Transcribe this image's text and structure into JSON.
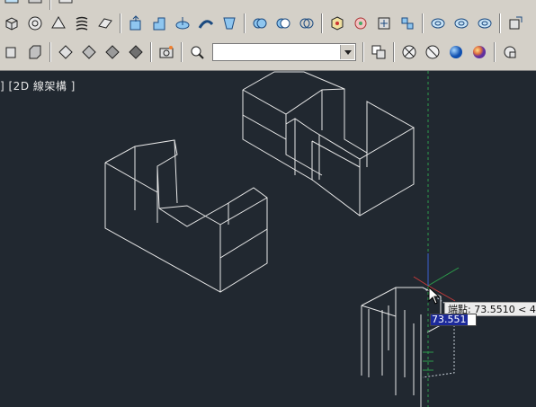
{
  "toolbar": {
    "view_combo_value": "",
    "row1_icons": [
      "box-icon",
      "sphere-icon",
      "cone-icon",
      "spring-icon",
      "surface-icon",
      "extrude-icon",
      "presspull-icon",
      "revolve-icon",
      "sweep-icon",
      "loft-icon",
      "union-icon",
      "subtract-icon",
      "intersect-icon",
      "3d-orbit-icon",
      "walk-icon",
      "3d-move-icon",
      "rotate-3d-icon",
      "align-icon",
      "mirror-icon",
      "array-icon",
      "ucs-icon"
    ],
    "row2_icons": [
      "wireframe-2d-icon",
      "wireframe-3d-icon",
      "hidden-icon",
      "realistic-icon",
      "conceptual-icon",
      "shaded-icon",
      "edges-icon",
      "camera-icon",
      "zoom-icon",
      "view-control-icon",
      "visual-style-icon",
      "material-icon",
      "sun-icon",
      "light-icon",
      "render-icon"
    ]
  },
  "viewport": {
    "label": "] [2D 線架構 ]"
  },
  "dynamic_input": {
    "tooltip": "端點: 73.5510 < 4",
    "value": "73.551"
  },
  "colors": {
    "background": "#212830",
    "wireframe": "#e8e8e8",
    "cursor_y": "#2d9c4b",
    "cursor_x": "#c73a3a",
    "cursor_z": "#3a5fd0"
  }
}
